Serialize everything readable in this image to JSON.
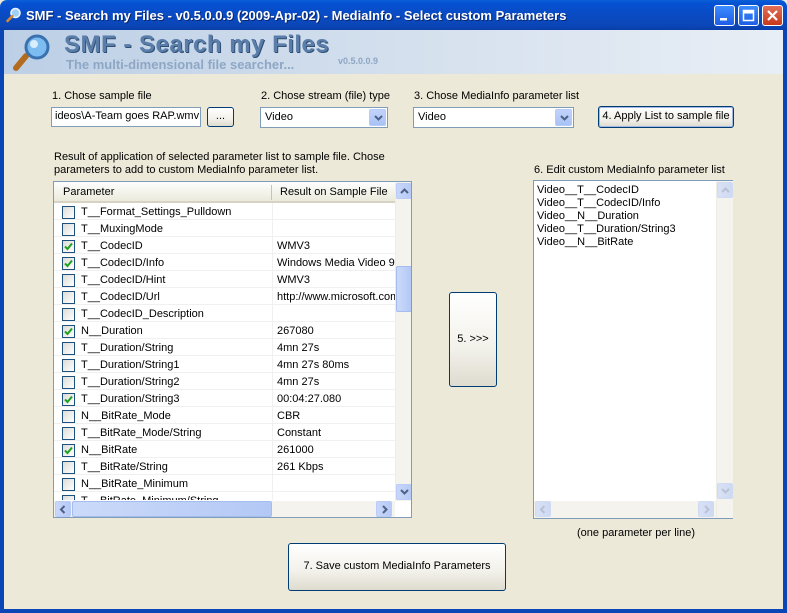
{
  "window": {
    "title": "SMF - Search my Files - v0.5.0.0.9 (2009-Apr-02) - MediaInfo - Select custom Parameters"
  },
  "banner": {
    "title": "SMF - Search my Files",
    "subtitle": "The multi-dimensional file searcher...",
    "version": "v0.5.0.0.9"
  },
  "step1": {
    "label": "1. Chose sample file",
    "value": "ideos\\A-Team goes RAP.wmv",
    "browse_label": "..."
  },
  "step2": {
    "label": "2. Chose stream (file) type",
    "value": "Video"
  },
  "step3": {
    "label": "3. Chose MediaInfo parameter list",
    "value": "Video"
  },
  "step4": {
    "label": "4. Apply List to sample file"
  },
  "result_caption": [
    "Result of application of selected parameter list to sample file. Chose",
    "parameters to add to custom MediaInfo parameter list."
  ],
  "list": {
    "columns": [
      "Parameter",
      "Result on Sample File"
    ],
    "rows": [
      {
        "param": "T__Format_Settings_Pulldown",
        "result": "",
        "checked": false
      },
      {
        "param": "T__MuxingMode",
        "result": "",
        "checked": false
      },
      {
        "param": "T__CodecID",
        "result": "WMV3",
        "checked": true
      },
      {
        "param": "T__CodecID/Info",
        "result": "Windows Media Video 9",
        "checked": true
      },
      {
        "param": "T__CodecID/Hint",
        "result": "WMV3",
        "checked": false
      },
      {
        "param": "T__CodecID/Url",
        "result": "http://www.microsoft.com",
        "checked": false
      },
      {
        "param": "T__CodecID_Description",
        "result": "",
        "checked": false
      },
      {
        "param": "N__Duration",
        "result": "267080",
        "checked": true
      },
      {
        "param": "T__Duration/String",
        "result": "4mn 27s",
        "checked": false
      },
      {
        "param": "T__Duration/String1",
        "result": "4mn 27s 80ms",
        "checked": false
      },
      {
        "param": "T__Duration/String2",
        "result": "4mn 27s",
        "checked": false
      },
      {
        "param": "T__Duration/String3",
        "result": "00:04:27.080",
        "checked": true
      },
      {
        "param": "N__BitRate_Mode",
        "result": "CBR",
        "checked": false
      },
      {
        "param": "T__BitRate_Mode/String",
        "result": "Constant",
        "checked": false
      },
      {
        "param": "N__BitRate",
        "result": "261000",
        "checked": true
      },
      {
        "param": "T__BitRate/String",
        "result": "261 Kbps",
        "checked": false
      },
      {
        "param": "N__BitRate_Minimum",
        "result": "",
        "checked": false
      },
      {
        "param": "T__BitRate_Minimum/String",
        "result": "",
        "checked": false
      }
    ]
  },
  "transfer_button": {
    "label": "5. >>>"
  },
  "step6": {
    "label": "6. Edit custom MediaInfo parameter list",
    "lines": [
      "Video__T__CodecID",
      "Video__T__CodecID/Info",
      "Video__N__Duration",
      "Video__T__Duration/String3",
      "Video__N__BitRate"
    ],
    "hint": "(one parameter per line)"
  },
  "step7": {
    "label": "7. Save custom MediaInfo Parameters"
  },
  "colors": {
    "titlebar": "#0b46b7",
    "face": "#ece9d8",
    "banner": "#bccfe6",
    "check": "#21a121"
  },
  "icons": [
    "magnifier-icon",
    "minimize-icon",
    "maximize-icon",
    "close-icon",
    "checkmark-icon",
    "chevron-down-icon",
    "scroll-arrow-icon"
  ]
}
